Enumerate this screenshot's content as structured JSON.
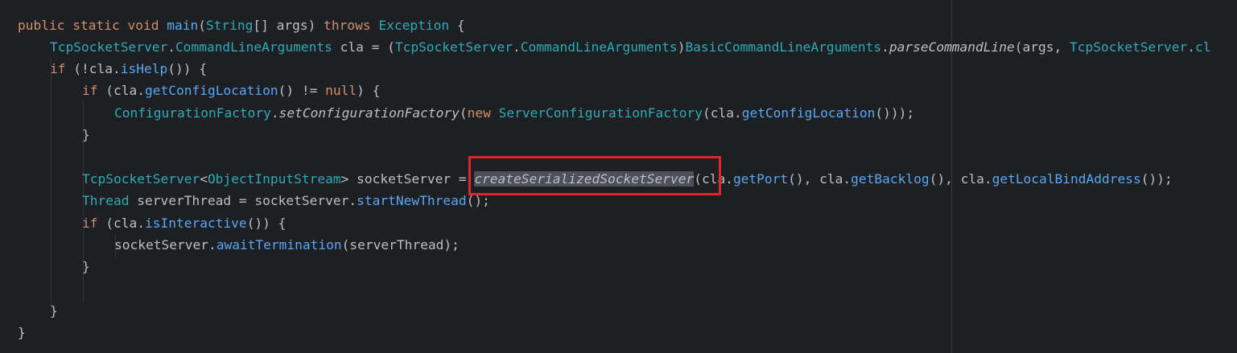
{
  "code": {
    "l1": {
      "kw_public": "public",
      "kw_static": "static",
      "kw_void": "void",
      "method_main": "main",
      "paren_open": "(",
      "type_string": "String",
      "arr_args": "[] args) ",
      "kw_throws": "throws",
      "type_exception": "Exception",
      "brace": " {"
    },
    "l2": {
      "type_tcp": "TcpSocketServer",
      "dot1": ".",
      "type_cla": "CommandLineArguments",
      "var_cla": " cla = (",
      "type_tcp2": "TcpSocketServer",
      "dot2": ".",
      "type_cla2": "CommandLineArguments",
      "close": ")",
      "type_basic": "BasicCommandLineArguments",
      "dot3": ".",
      "method_parse": "parseCommandLine",
      "args": "(args, ",
      "type_tcp3": "TcpSocketServer",
      "dot4": ".",
      "tail": "cl"
    },
    "l3": {
      "kw_if": "if",
      "open": " (!cla.",
      "method_ishelp": "isHelp",
      "close": "()) {"
    },
    "l4": {
      "kw_if": "if",
      "open": " (cla.",
      "method_getcfg": "getConfigLocation",
      "mid": "() != ",
      "kw_null": "null",
      "close": ") {"
    },
    "l5": {
      "type_cf": "ConfigurationFactory",
      "dot": ".",
      "method_setcf": "setConfigurationFactory",
      "open": "(",
      "kw_new": "new",
      "sp": " ",
      "type_scf": "ServerConfigurationFactory",
      "mid": "(cla.",
      "method_getcfg": "getConfigLocation",
      "close": "()));"
    },
    "l6": {
      "brace": "}"
    },
    "l8": {
      "type_tcp": "TcpSocketServer",
      "lt": "<",
      "type_ois": "ObjectInputStream",
      "gt": "> socketServer = ",
      "method_create": "createSerializedSocketServer",
      "open": "(cla.",
      "method_getport": "getPort",
      "mid1": "(), cla.",
      "method_getbacklog": "getBacklog",
      "mid2": "(), cla.",
      "method_getlocal": "getLocalBindAddress",
      "close": "());"
    },
    "l9": {
      "type_thread": "Thread",
      "mid": " serverThread = socketServer.",
      "method_start": "startNewThread",
      "close": "();"
    },
    "l10": {
      "kw_if": "if",
      "open": " (cla.",
      "method_isint": "isInteractive",
      "close": "()) {"
    },
    "l11": {
      "pre": "socketServer.",
      "method_await": "awaitTermination",
      "close": "(serverThread);"
    },
    "l12": {
      "brace": "}"
    },
    "l14": {
      "brace": "}"
    },
    "l15": {
      "brace": "}"
    }
  },
  "colors": {
    "background": "#1e1f22",
    "keyword": "#cf8e6d",
    "type": "#2aacb8",
    "method": "#56a8f5",
    "text": "#bcbec4",
    "highlight_box": "#e0252b",
    "selection": "#4b5059"
  }
}
